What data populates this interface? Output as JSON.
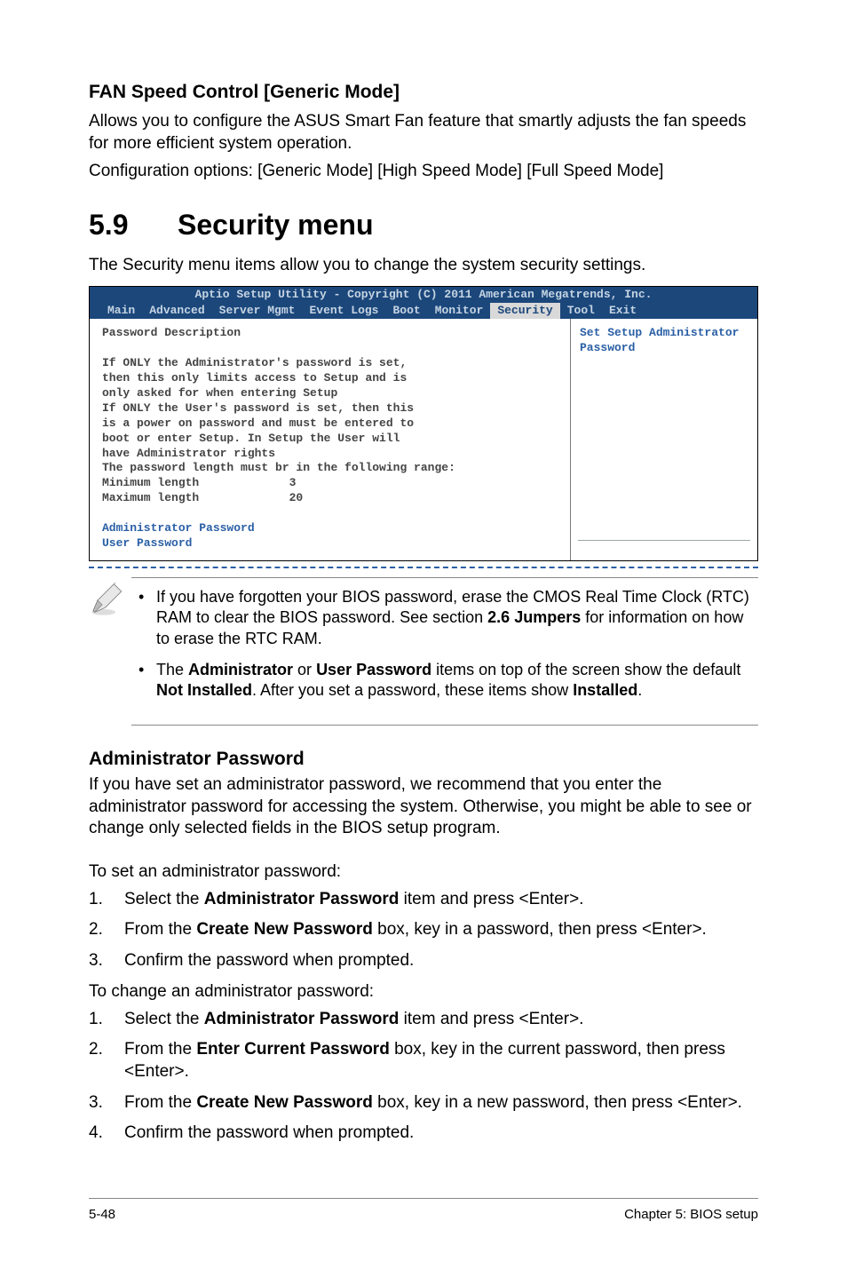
{
  "fan": {
    "heading": "FAN Speed Control [Generic Mode]",
    "p1": "Allows you to configure the ASUS Smart Fan feature that smartly adjusts the fan speeds for more efficient system operation.",
    "p2": "Configuration options: [Generic Mode] [High Speed Mode] [Full Speed Mode]"
  },
  "section": {
    "num": "5.9",
    "title": "Security menu",
    "intro": "The Security menu items allow you to change the system security settings."
  },
  "bios": {
    "title": "Aptio Setup Utility - Copyright (C) 2011 American Megatrends, Inc.",
    "tabs": [
      "Main",
      "Advanced",
      "Server Mgmt",
      "Event Logs",
      "Boot",
      "Monitor",
      "Security",
      "Tool",
      "Exit"
    ],
    "active_tab": "Security",
    "left_heading": "Password Description",
    "left_body": "If ONLY the Administrator's password is set,\nthen this only limits access to Setup and is\nonly asked for when entering Setup\nIf ONLY the User's password is set, then this\nis a power on password and must be entered to\nboot or enter Setup. In Setup the User will\nhave Administrator rights\nThe password length must br in the following range:\nMinimum length             3\nMaximum length             20",
    "left_links": "Administrator Password\nUser Password",
    "right": "Set Setup Administrator Password"
  },
  "notes": {
    "n1a": "If you have forgotten your BIOS password, erase the CMOS Real Time Clock (RTC) RAM to clear the BIOS password. See section ",
    "n1b": "2.6 Jumpers",
    "n1c": " for information on how to erase the RTC RAM.",
    "n2a": "The ",
    "n2b": "Administrator",
    "n2c": " or ",
    "n2d": "User Password",
    "n2e": " items on top of the screen show the default ",
    "n2f": "Not Installed",
    "n2g": ". After you set a password, these items show ",
    "n2h": "Installed",
    "n2i": "."
  },
  "admin": {
    "heading": "Administrator Password",
    "para": "If you have set an administrator password, we recommend that you enter the administrator password for accessing the system. Otherwise, you might be able to see or change only selected fields in the BIOS setup program.",
    "set_title": "To set an administrator password:",
    "set_steps": [
      {
        "pre": "Select the ",
        "b": "Administrator Password",
        "post": " item and press <Enter>."
      },
      {
        "pre": "From the ",
        "b": "Create New Password",
        "post": " box, key in a password, then press <Enter>."
      },
      {
        "pre": "Confirm the password when prompted.",
        "b": "",
        "post": ""
      }
    ],
    "change_title": "To change an administrator password:",
    "change_steps": [
      {
        "pre": "Select the ",
        "b": "Administrator Password",
        "post": " item and press <Enter>."
      },
      {
        "pre": "From the ",
        "b": "Enter Current Password",
        "post": " box, key in the current password, then press <Enter>."
      },
      {
        "pre": "From the ",
        "b": "Create New Password",
        "post": " box, key in a new password, then press <Enter>."
      },
      {
        "pre": "Confirm the password when prompted.",
        "b": "",
        "post": ""
      }
    ]
  },
  "footer": {
    "left": "5-48",
    "right": "Chapter 5: BIOS setup"
  }
}
